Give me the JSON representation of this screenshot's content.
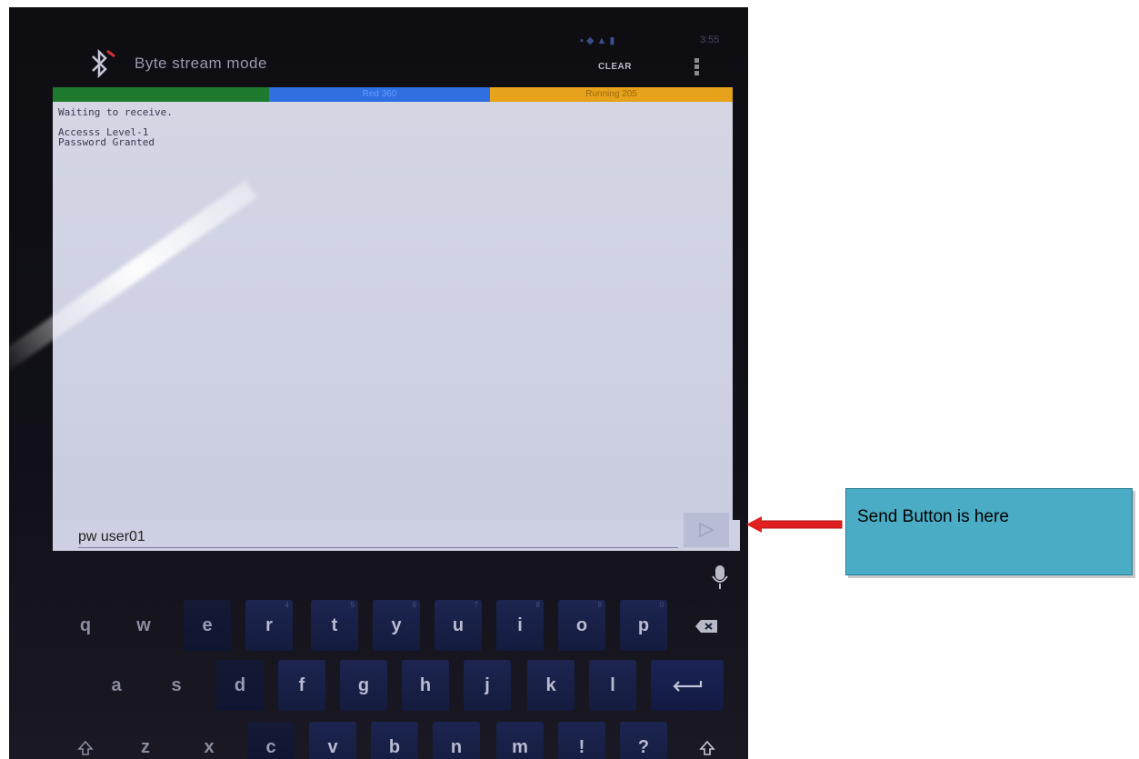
{
  "app": {
    "title": "Byte stream mode",
    "clear_label": "CLEAR",
    "status_time": "3:55"
  },
  "status_strip": {
    "segment_blue_label": "Red 360",
    "segment_yellow_label": "Running 205"
  },
  "terminal": {
    "lines": "Waiting to receive.\n\nAccesss Level-1\nPassword Granted"
  },
  "input": {
    "value": "pw user01"
  },
  "keyboard": {
    "row1": [
      {
        "label": "q",
        "alt": ""
      },
      {
        "label": "w",
        "alt": ""
      },
      {
        "label": "e",
        "alt": ""
      },
      {
        "label": "r",
        "alt": "4"
      },
      {
        "label": "t",
        "alt": "5"
      },
      {
        "label": "y",
        "alt": "6"
      },
      {
        "label": "u",
        "alt": "7"
      },
      {
        "label": "i",
        "alt": "8"
      },
      {
        "label": "o",
        "alt": "9"
      },
      {
        "label": "p",
        "alt": "0"
      }
    ],
    "row2": [
      "a",
      "s",
      "d",
      "f",
      "g",
      "h",
      "j",
      "k",
      "l"
    ],
    "row3": [
      "z",
      "x",
      "c",
      "v",
      "b",
      "n",
      "m",
      "!",
      "?"
    ],
    "backspace_icon": "backspace-icon",
    "enter_icon": "enter-icon",
    "shift_icon": "shift-icon",
    "mic_icon": "microphone-icon"
  },
  "annotation": {
    "text": "Send Button is here",
    "color": "#4aacc5",
    "arrow_color": "#e02020"
  },
  "colors": {
    "strip_green": "#1e7a2e",
    "strip_blue": "#2f6fe0",
    "strip_yellow": "#e5a21a",
    "terminal_bg": "#d0d3e4"
  }
}
